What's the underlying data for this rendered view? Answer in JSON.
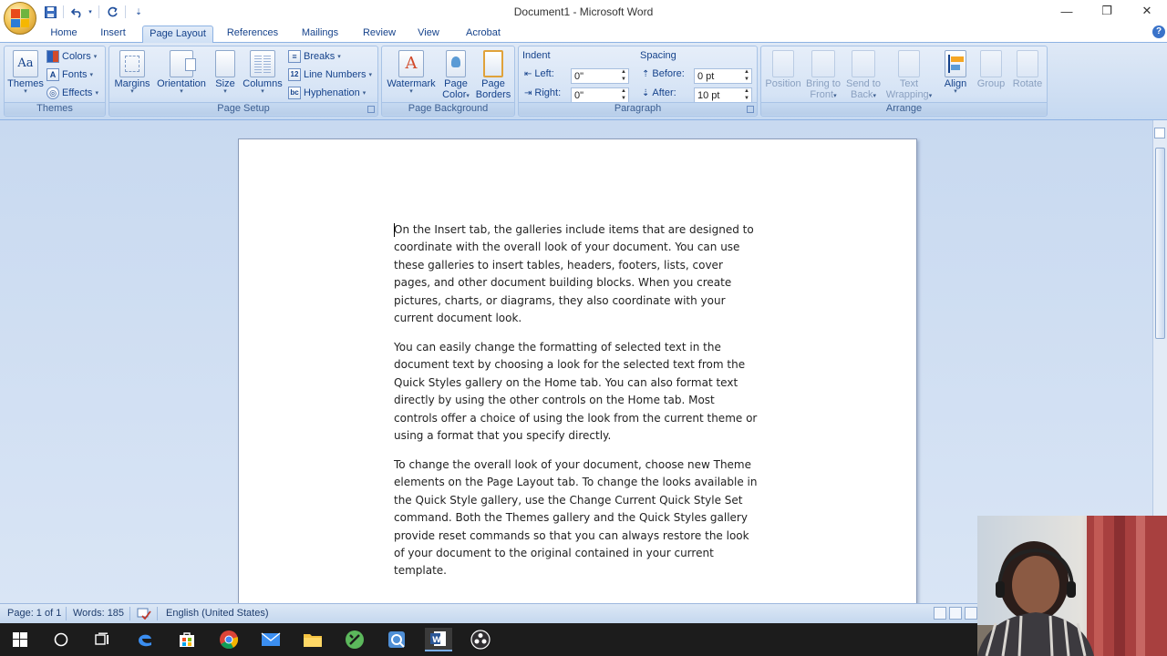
{
  "window": {
    "title": "Document1 - Microsoft Word",
    "minimize_glyph": "—",
    "restore_glyph": "❐",
    "close_glyph": "✕"
  },
  "qat": {
    "save_icon": "save-icon",
    "undo_icon": "undo-icon",
    "redo_icon": "repeat-icon",
    "customize_icon": "customize-arrow-icon"
  },
  "tabs": [
    "Home",
    "Insert",
    "Page Layout",
    "References",
    "Mailings",
    "Review",
    "View",
    "Acrobat"
  ],
  "active_tab": "Page Layout",
  "help": "?",
  "ribbon": {
    "themes": {
      "group_label": "Themes",
      "themes_btn": "Themes",
      "themes_icon_text": "Aa",
      "colors": "Colors",
      "fonts": "Fonts",
      "effects": "Effects"
    },
    "page_setup": {
      "group_label": "Page Setup",
      "margins": "Margins",
      "orientation": "Orientation",
      "size": "Size",
      "columns": "Columns",
      "breaks": "Breaks",
      "line_numbers": "Line Numbers",
      "hyphenation": "Hyphenation"
    },
    "page_background": {
      "group_label": "Page Background",
      "watermark": "Watermark",
      "watermark_icon_text": "A",
      "page_color_1": "Page",
      "page_color_2": "Color",
      "page_borders_1": "Page",
      "page_borders_2": "Borders"
    },
    "paragraph": {
      "group_label": "Paragraph",
      "indent_heading": "Indent",
      "left_label": "Left:",
      "left_value": "0\"",
      "right_label": "Right:",
      "right_value": "0\"",
      "spacing_heading": "Spacing",
      "before_label": "Before:",
      "before_value": "0 pt",
      "after_label": "After:",
      "after_value": "10 pt"
    },
    "arrange": {
      "group_label": "Arrange",
      "position": "Position",
      "bring_front_1": "Bring to",
      "bring_front_2": "Front",
      "send_back_1": "Send to",
      "send_back_2": "Back",
      "text_wrap_1": "Text",
      "text_wrap_2": "Wrapping",
      "align": "Align",
      "group": "Group",
      "rotate": "Rotate"
    }
  },
  "document": {
    "paragraphs": [
      "On the Insert tab, the galleries include items that are designed to coordinate with the overall look of your document. You can use these galleries to insert tables, headers, footers, lists, cover pages, and other document building blocks. When you create pictures, charts, or diagrams, they also coordinate with your current document look.",
      "You can easily change the formatting of selected text in the document text by choosing a look for the selected text from the Quick Styles gallery on the Home tab. You can also format text directly by using the other controls on the Home tab. Most controls offer a choice of using the look from the current theme or using a format that you specify directly.",
      "To change the overall look of your document, choose new Theme elements on the Page Layout tab. To change the looks available in the Quick Style gallery, use the Change Current Quick Style Set command. Both the Themes gallery and the Quick Styles gallery provide reset commands so that you can always restore the look of your document to the original contained in your current template."
    ]
  },
  "status": {
    "page": "Page: 1 of 1",
    "words": "Words: 185",
    "language": "English (United States)"
  },
  "taskbar": {
    "apps": [
      "windows-start-icon",
      "cortana-icon",
      "task-view-icon",
      "edge-icon",
      "store-icon",
      "chrome-icon",
      "mail-icon",
      "file-explorer-icon",
      "app-icon",
      "app2-icon",
      "word-icon",
      "obs-icon"
    ]
  },
  "colors": {
    "ribbon_text": "#15428b",
    "ribbon_bg": "#c6d9f1",
    "workspace_bg": "#cfdcef",
    "taskbar_bg": "#1c1c1c"
  }
}
